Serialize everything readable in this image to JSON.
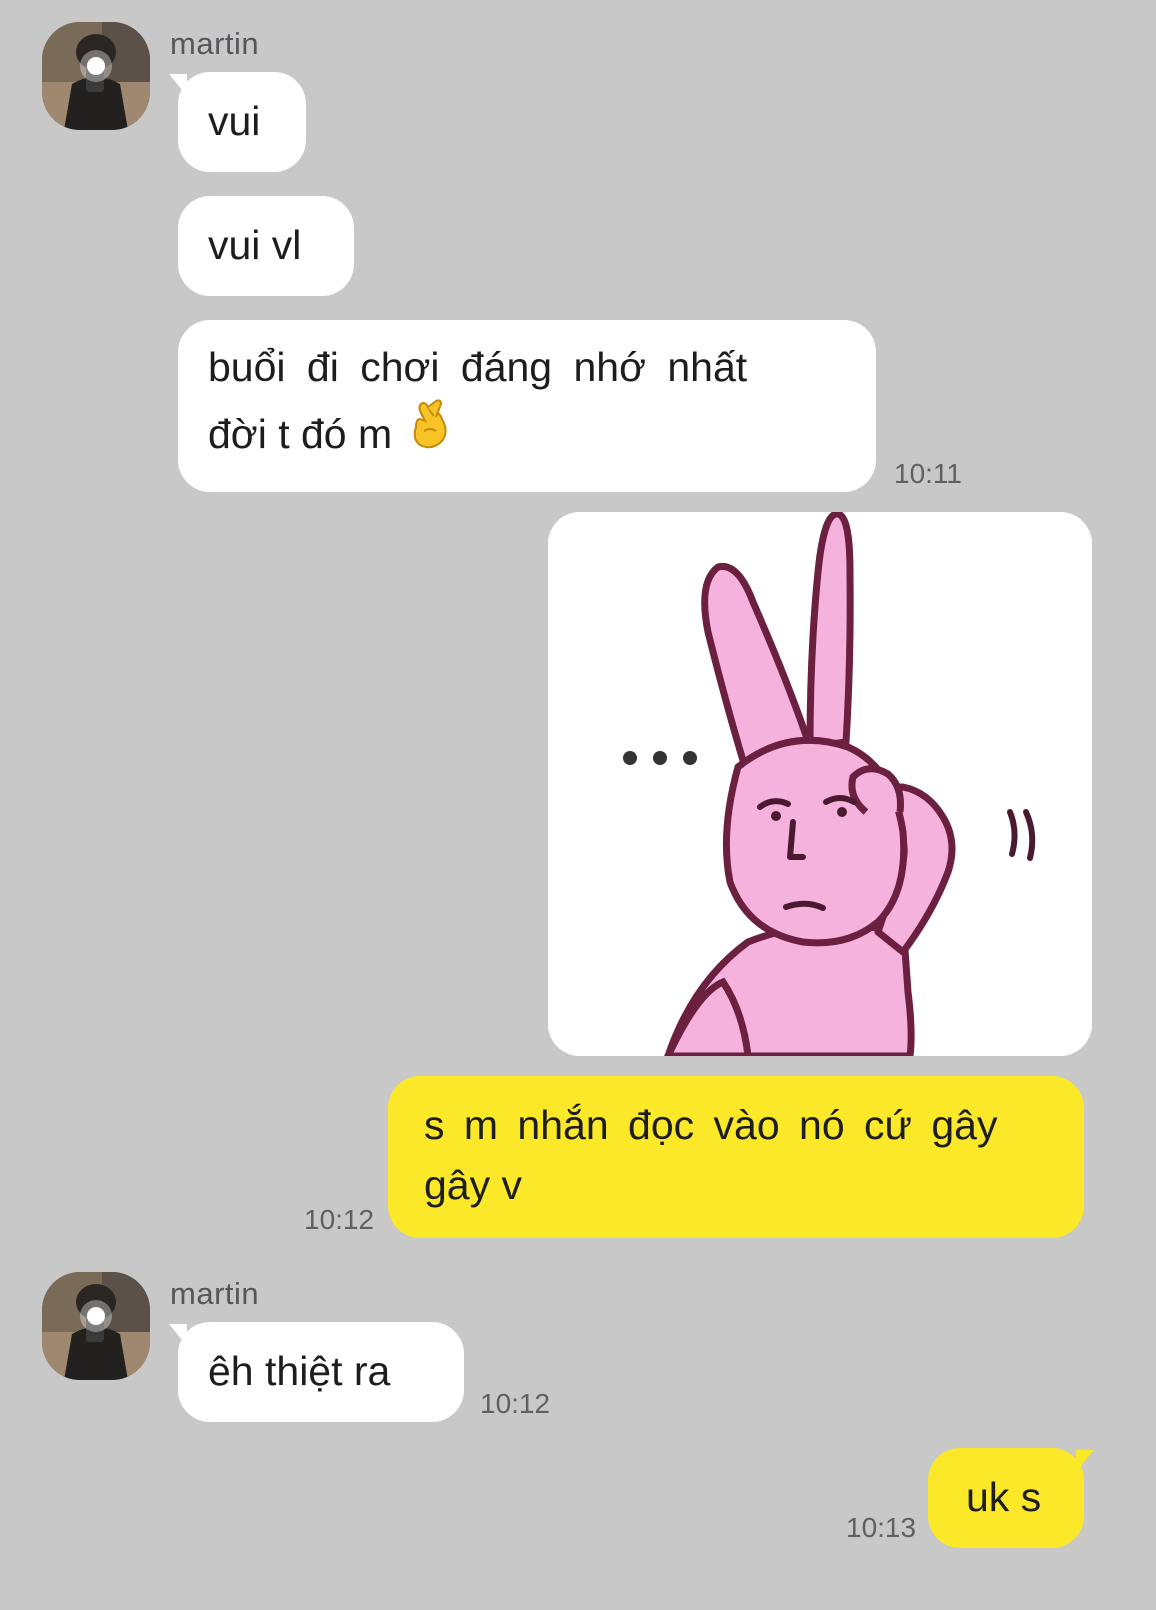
{
  "chat": {
    "sender_name_1": "martin",
    "sender_name_2": "martin",
    "messages": {
      "m1": "vui",
      "m2": "vui vl",
      "m3_line1": "buổi đi chơi đáng nhớ nhất",
      "m3_line2": "đời t đó m",
      "m3_emoji": "crossed-fingers-emoji",
      "m3_time": "10:11",
      "sticker": "pink-bunny-scratching-head-sticker",
      "sticker_dots": "...",
      "m5_line1": "s m nhắn đọc vào nó cứ gây",
      "m5_line2": "gây v",
      "m5_time": "10:12",
      "m6": "êh thiệt ra",
      "m6_time": "10:12",
      "m7": "uk s",
      "m7_time": "10:13"
    }
  },
  "colors": {
    "background": "#c8c8c8",
    "incoming_bubble": "#ffffff",
    "outgoing_bubble": "#fbe829",
    "bunny_pink": "#f5b2dc",
    "text": "#1d1d1d",
    "meta_text": "#5e6062"
  }
}
